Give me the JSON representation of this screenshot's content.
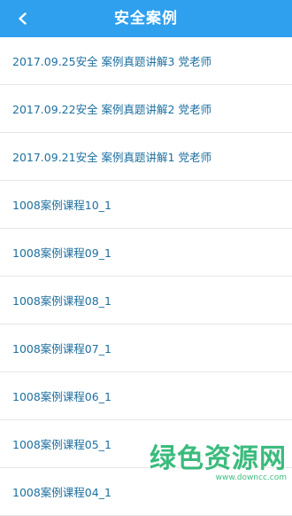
{
  "header": {
    "title": "安全案例",
    "back_icon": "chevron-left-icon"
  },
  "items": [
    {
      "label": "2017.09.25安全 案例真题讲解3 党老师"
    },
    {
      "label": "2017.09.22安全 案例真题讲解2 党老师"
    },
    {
      "label": "2017.09.21安全 案例真题讲解1 党老师"
    },
    {
      "label": "1008案例课程10_1"
    },
    {
      "label": "1008案例课程09_1"
    },
    {
      "label": "1008案例课程08_1"
    },
    {
      "label": "1008案例课程07_1"
    },
    {
      "label": "1008案例课程06_1"
    },
    {
      "label": "1008案例课程05_1"
    },
    {
      "label": "1008案例课程04_1"
    }
  ],
  "watermark": {
    "main": "绿色资源网",
    "sub": "www.downcc.com"
  },
  "colors": {
    "header_bg": "#2fa0ee",
    "item_text": "#1e6fa0",
    "watermark": "#2bb673"
  }
}
